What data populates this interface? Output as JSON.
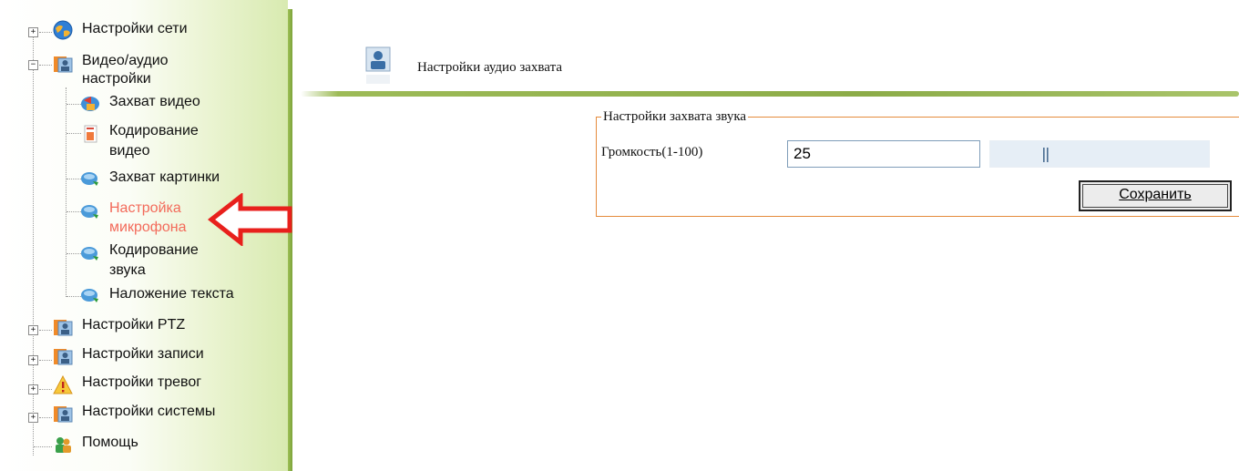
{
  "sidebar": {
    "items": [
      {
        "label": "Настройки сети",
        "icon": "network-globe-icon",
        "expander": "+"
      },
      {
        "label_line1": "Видео/аудио",
        "label_line2": "настройки",
        "icon": "user-folder-icon",
        "expander": "−"
      },
      {
        "label": "Захват видео",
        "icon": "video-capture-icon"
      },
      {
        "label_line1": "Кодирование",
        "label_line2": "видео",
        "icon": "document-icon"
      },
      {
        "label": "Захват картинки",
        "icon": "chat-bubble-icon"
      },
      {
        "label_line1": "Настройка",
        "label_line2": "микрофона",
        "icon": "chat-bubble-icon",
        "active": true
      },
      {
        "label_line1": "Кодирование",
        "label_line2": "звука",
        "icon": "chat-bubble-icon"
      },
      {
        "label": "Наложение текста",
        "icon": "chat-bubble-icon"
      },
      {
        "label": "Настройки PTZ",
        "icon": "user-folder-icon",
        "expander": "+"
      },
      {
        "label": "Настройки записи",
        "icon": "user-folder-icon",
        "expander": "+"
      },
      {
        "label": "Настройки тревог",
        "icon": "warning-icon",
        "expander": "+"
      },
      {
        "label": "Настройки системы",
        "icon": "user-folder-icon",
        "expander": "+"
      },
      {
        "label": "Помощь",
        "icon": "help-users-icon"
      }
    ]
  },
  "main": {
    "title": "Настройки аудио захвата",
    "group": {
      "legend": "Настройки захвата звука",
      "volume_label": "Громкость(1-100)",
      "volume_value": "25",
      "volume_level": 25,
      "save_label": "Сохранить"
    }
  },
  "colors": {
    "active_item": "#f36a5a",
    "sidebar_green": "#8cac48",
    "group_border": "#e58b3c",
    "annotation_arrow": "#e8201c"
  }
}
